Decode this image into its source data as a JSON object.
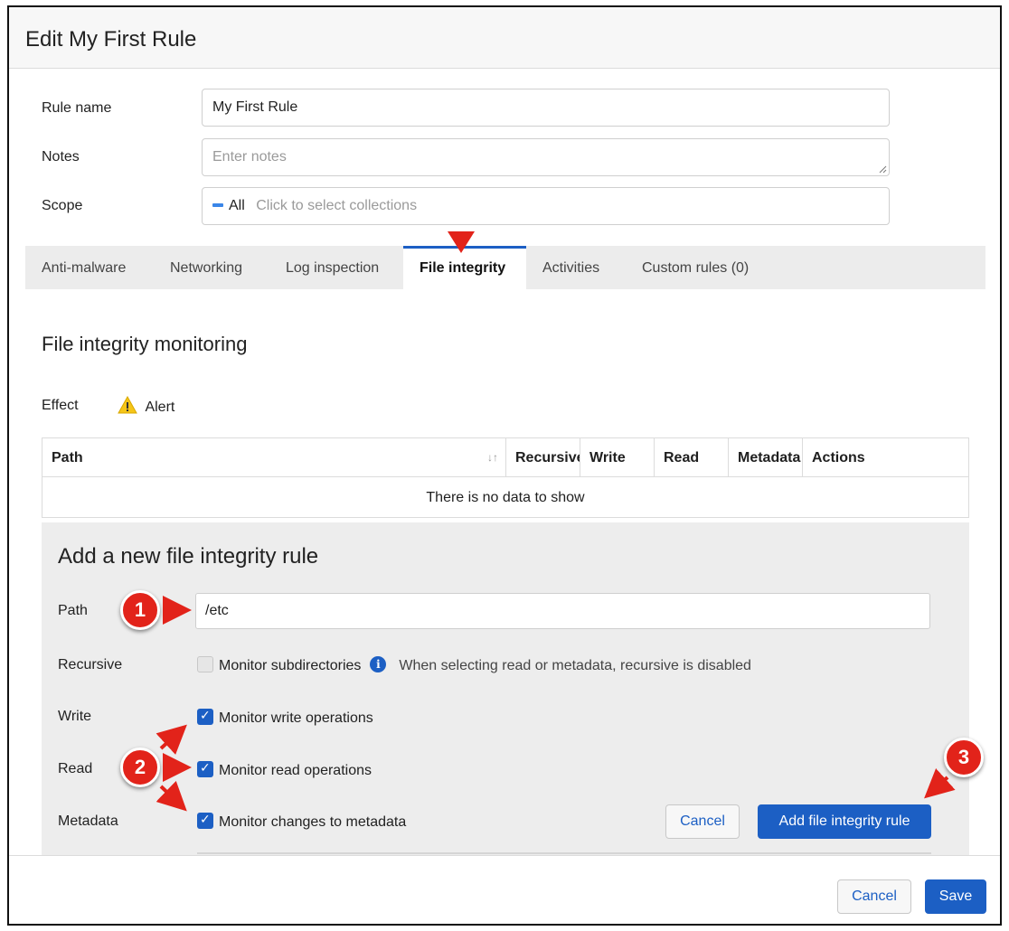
{
  "modal": {
    "title": "Edit My First Rule"
  },
  "form": {
    "rule_name_label": "Rule name",
    "rule_name_value": "My First Rule",
    "notes_label": "Notes",
    "notes_placeholder": "Enter notes",
    "scope_label": "Scope",
    "scope_tag": "All",
    "scope_placeholder": "Click to select collections"
  },
  "tabs": [
    {
      "label": "Anti-malware"
    },
    {
      "label": "Networking"
    },
    {
      "label": "Log inspection"
    },
    {
      "label": "File integrity"
    },
    {
      "label": "Activities"
    },
    {
      "label": "Custom rules (0)"
    }
  ],
  "active_tab": "File integrity",
  "fim": {
    "title": "File integrity monitoring",
    "effect_label": "Effect",
    "effect_value": "Alert",
    "table": {
      "columns": [
        "Path",
        "Recursive",
        "Write",
        "Read",
        "Metadata",
        "Actions"
      ],
      "empty_text": "There is no data to show"
    }
  },
  "new_rule": {
    "title": "Add a new file integrity rule",
    "path_label": "Path",
    "path_value": "/etc",
    "recursive_label": "Recursive",
    "recursive_option": "Monitor subdirectories",
    "recursive_hint": "When selecting read or metadata, recursive is disabled",
    "write_label": "Write",
    "write_option": "Monitor write operations",
    "read_label": "Read",
    "read_option": "Monitor read operations",
    "metadata_label": "Metadata",
    "metadata_option": "Monitor changes to metadata",
    "cancel_label": "Cancel",
    "add_label": "Add file integrity rule"
  },
  "footer": {
    "cancel_label": "Cancel",
    "save_label": "Save"
  },
  "annotations": {
    "badge_1": "1",
    "badge_2": "2",
    "badge_3": "3"
  },
  "colors": {
    "primary": "#1c5fc4",
    "annotation": "#e2231a",
    "warning": "#f5c518"
  },
  "icons": {
    "effect": "warning-icon",
    "info": "info-icon",
    "sort": "sort-icon"
  }
}
